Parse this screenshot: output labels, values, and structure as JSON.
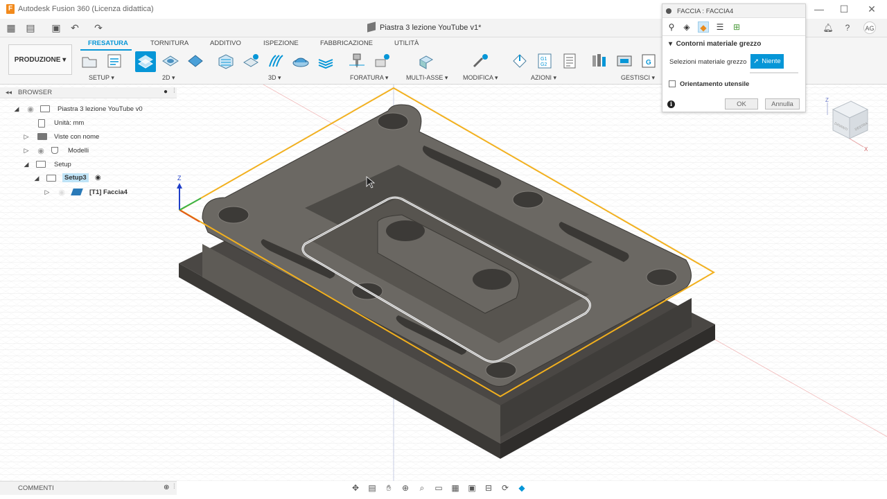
{
  "window": {
    "app_logo": "F",
    "title": "Autodesk Fusion 360 (Licenza didattica)",
    "controls": [
      "—",
      "☐",
      "✕"
    ]
  },
  "quick_access": {
    "document_tab": "Piastra 3 lezione YouTube v1*",
    "avatar": "AG"
  },
  "toolbar": {
    "workspace": "PRODUZIONE",
    "tabs": [
      "FRESATURA",
      "TORNITURA",
      "ADDITIVO",
      "ISPEZIONE",
      "FABBRICAZIONE",
      "UTILITÀ"
    ],
    "active_tab": "FRESATURA",
    "groups": [
      "SETUP",
      "2D",
      "3D",
      "FORATURA",
      "MULTI-ASSE",
      "MODIFICA",
      "AZIONI",
      "GESTISCI"
    ]
  },
  "browser": {
    "title": "BROWSER",
    "items": [
      {
        "label": "Piastra 3 lezione YouTube v0"
      },
      {
        "label": "Unità: mm"
      },
      {
        "label": "Viste con nome"
      },
      {
        "label": "Modelli"
      },
      {
        "label": "Setup"
      },
      {
        "label": "Setup3"
      },
      {
        "label": "[T1] Faccia4"
      }
    ]
  },
  "dialog": {
    "title": "FACCIA : FACCIA4",
    "section": "Contorni materiale grezzo",
    "select_label": "Selezioni materiale grezzo",
    "select_button": "Niente",
    "checkbox_label": "Orientamento utensile",
    "checkbox_checked": false,
    "ok": "OK",
    "cancel": "Annulla",
    "info_icon": "i"
  },
  "comments": {
    "title": "COMMENTI"
  },
  "viewcube": {
    "faces": [
      "DAVANTI",
      "DESTRA"
    ],
    "axes": [
      "Z",
      "X"
    ]
  },
  "colors": {
    "accent": "#0696d7",
    "stock_outline": "#f2b01e",
    "part": "#5b5853"
  }
}
